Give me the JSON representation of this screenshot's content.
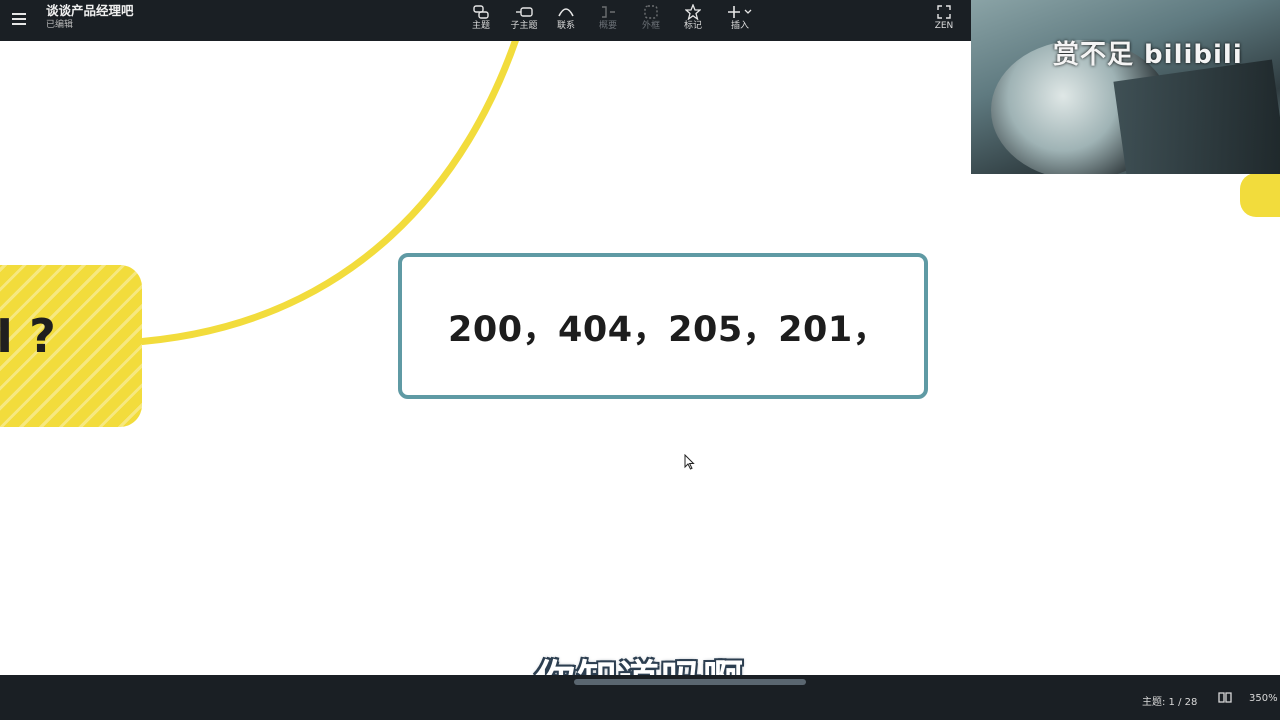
{
  "app": {
    "doc_title": "谈谈产品经理吧",
    "doc_status": "已编辑"
  },
  "toolbar": {
    "topic": "主题",
    "subtopic": "子主题",
    "relationship": "联系",
    "summary": "概要",
    "boundary": "外框",
    "marker": "标记",
    "insert": "插入",
    "zen": "ZEN"
  },
  "overlay": {
    "watermark": "赏不足 bilibili"
  },
  "canvas": {
    "yellow_node_text": "I ?",
    "topic_text": "200，404，205，201，",
    "subtitle": "你知道吗啊"
  },
  "statusbar": {
    "topic_count": "主题: 1 / 28",
    "zoom": "350%"
  },
  "colors": {
    "toolbar_bg": "#1a1f24",
    "connector": "#f2dc3c",
    "topic_border": "#5f9aa4",
    "yellow_node": "#f2dc3c"
  }
}
